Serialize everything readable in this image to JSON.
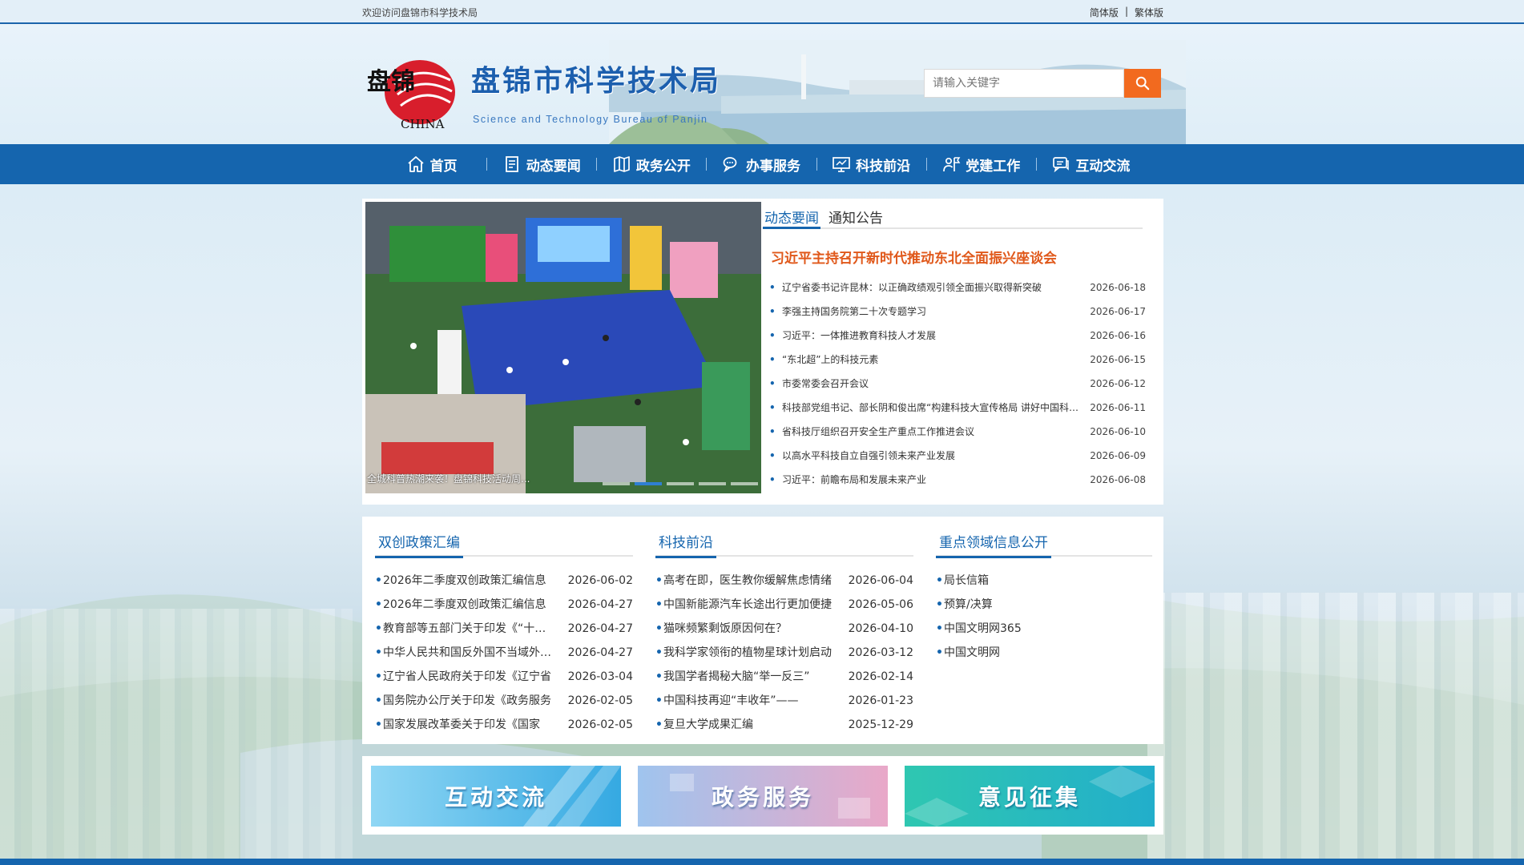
{
  "topbar": {
    "welcome": "欢迎访问盘锦市科学技术局",
    "lang_simplified": "简体版",
    "lang_separator": "|",
    "lang_traditional": "繁体版"
  },
  "header": {
    "seal_text": "盘锦",
    "seal_china": "CHINA",
    "title": "盘锦市科学技术局",
    "subtitle": "Science and Technology Bureau of Panjin",
    "search_placeholder": "请输入关键字"
  },
  "nav": [
    {
      "label": "首页",
      "icon": "home-icon"
    },
    {
      "label": "动态要闻",
      "icon": "document-icon"
    },
    {
      "label": "政务公开",
      "icon": "map-icon"
    },
    {
      "label": "办事服务",
      "icon": "chat-icon"
    },
    {
      "label": "科技前沿",
      "icon": "monitor-icon"
    },
    {
      "label": "党建工作",
      "icon": "person-flag-icon"
    },
    {
      "label": "互动交流",
      "icon": "message-icon"
    }
  ],
  "carousel": {
    "caption": "全城科普热潮来袭！盘锦科技活动周...",
    "active_slide": 2,
    "slide_count": 5
  },
  "news": {
    "tabs": [
      "动态要闻",
      "通知公告"
    ],
    "active_tab": 0,
    "headline": "习近平主持召开新时代推动东北全面振兴座谈会",
    "items": [
      {
        "title": "辽宁省委书记许昆林：以正确政绩观引领全面振兴取得新突破",
        "date": "2026-06-18"
      },
      {
        "title": "李强主持国务院第二十次专题学习",
        "date": "2026-06-17"
      },
      {
        "title": "习近平：一体推进教育科技人才发展",
        "date": "2026-06-16"
      },
      {
        "title": "“东北超”上的科技元素",
        "date": "2026-06-15"
      },
      {
        "title": "市委常委会召开会议",
        "date": "2026-06-12"
      },
      {
        "title": "科技部党组书记、部长阴和俊出席“构建科技大宣传格局 讲好中国科技故事”",
        "date": "2026-06-11"
      },
      {
        "title": "省科技厅组织召开安全生产重点工作推进会议",
        "date": "2026-06-10"
      },
      {
        "title": "以高水平科技自立自强引领未来产业发展",
        "date": "2026-06-09"
      },
      {
        "title": "习近平：前瞻布局和发展未来产业",
        "date": "2026-06-08"
      }
    ]
  },
  "columns": [
    {
      "title": "双创政策汇编",
      "items": [
        {
          "title": "2026年二季度双创政策汇编信息",
          "date": "2026-06-02"
        },
        {
          "title": "2026年二季度双创政策汇编信息",
          "date": "2026-04-27"
        },
        {
          "title": "教育部等五部门关于印发《“十四五”",
          "date": "2026-04-27"
        },
        {
          "title": "中华人民共和国反外国不当域外管辖",
          "date": "2026-04-27"
        },
        {
          "title": "辽宁省人民政府关于印发《辽宁省",
          "date": "2026-03-04"
        },
        {
          "title": "国务院办公厅关于印发《政务服务",
          "date": "2026-02-05"
        },
        {
          "title": "国家发展改革委关于印发《国家",
          "date": "2026-02-05"
        }
      ]
    },
    {
      "title": "科技前沿",
      "items": [
        {
          "title": "高考在即，医生教你缓解焦虑情绪",
          "date": "2026-06-04"
        },
        {
          "title": "中国新能源汽车长途出行更加便捷",
          "date": "2026-05-06"
        },
        {
          "title": "猫咪频繁剩饭原因何在？",
          "date": "2026-04-10"
        },
        {
          "title": "我科学家领衔的植物星球计划启动",
          "date": "2026-03-12"
        },
        {
          "title": "我国学者揭秘大脑“举一反三”",
          "date": "2026-02-14"
        },
        {
          "title": "中国科技再迎“丰收年”——",
          "date": "2026-01-23"
        },
        {
          "title": "复旦大学成果汇编",
          "date": "2025-12-29"
        }
      ]
    },
    {
      "title": "重点领域信息公开",
      "items": [
        {
          "title": "局长信箱",
          "date": ""
        },
        {
          "title": "预算/决算",
          "date": ""
        },
        {
          "title": "中国文明网365",
          "date": ""
        },
        {
          "title": "中国文明网",
          "date": ""
        }
      ]
    }
  ],
  "banners": [
    {
      "label": "互动交流",
      "color_a": "#7fd0f2",
      "color_b": "#2aa6e0"
    },
    {
      "label": "政务服务",
      "color_a": "#9ec3ee",
      "color_b": "#e8a9c8"
    },
    {
      "label": "意见征集",
      "color_a": "#2fc7b3",
      "color_b": "#1fb0c9"
    }
  ],
  "colors": {
    "primary": "#1565ae",
    "accent": "#e0581a",
    "search_button": "#f26a1f"
  }
}
